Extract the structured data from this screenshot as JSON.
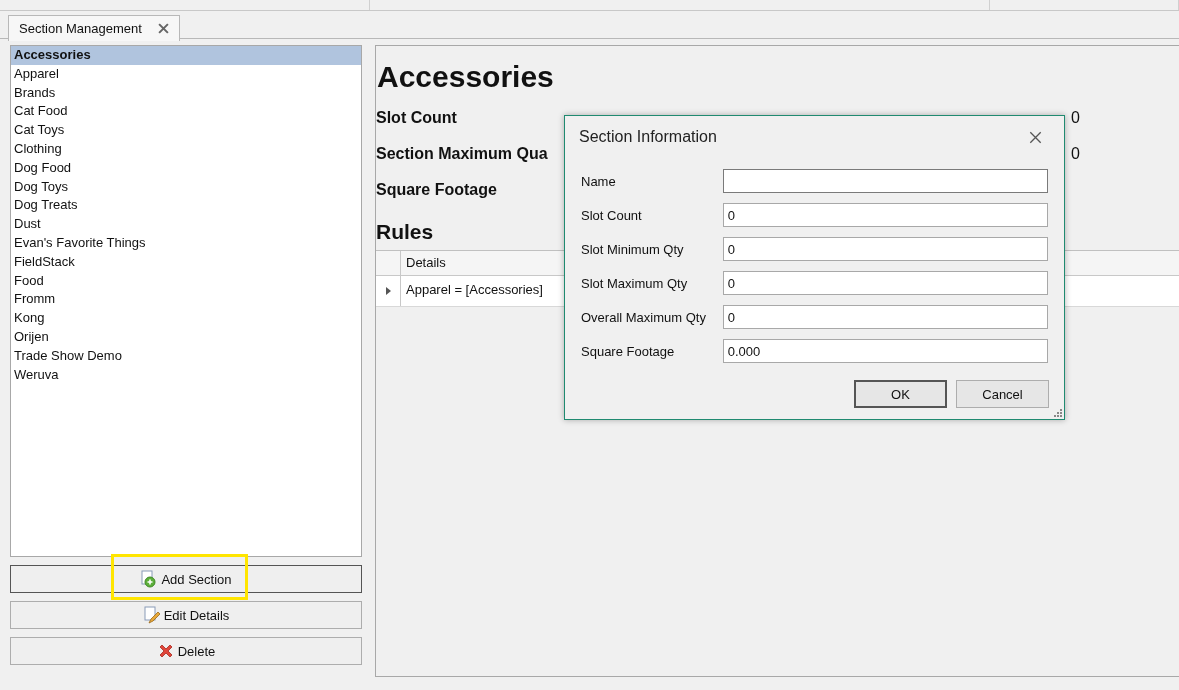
{
  "tabs": [
    {
      "label": "Section Management",
      "selected": true
    }
  ],
  "sections": [
    {
      "label": "Accessories",
      "selected": true
    },
    {
      "label": "Apparel",
      "selected": false
    },
    {
      "label": "Brands",
      "selected": false
    },
    {
      "label": "Cat Food",
      "selected": false
    },
    {
      "label": "Cat Toys",
      "selected": false
    },
    {
      "label": "Clothing",
      "selected": false
    },
    {
      "label": "Dog Food",
      "selected": false
    },
    {
      "label": "Dog Toys",
      "selected": false
    },
    {
      "label": "Dog Treats",
      "selected": false
    },
    {
      "label": "Dust",
      "selected": false
    },
    {
      "label": "Evan's Favorite Things",
      "selected": false
    },
    {
      "label": "FieldStack",
      "selected": false
    },
    {
      "label": "Food",
      "selected": false
    },
    {
      "label": "Fromm",
      "selected": false
    },
    {
      "label": "Kong",
      "selected": false
    },
    {
      "label": "Orijen",
      "selected": false
    },
    {
      "label": "Trade Show Demo",
      "selected": false
    },
    {
      "label": "Weruva",
      "selected": false
    }
  ],
  "actions": [
    {
      "label": "Add Section",
      "kind": "add",
      "highlighted": true
    },
    {
      "label": "Edit Details",
      "kind": "edit",
      "highlighted": false
    },
    {
      "label": "Delete",
      "kind": "delete",
      "highlighted": false
    }
  ],
  "detail": {
    "title": "Accessories",
    "fields": [
      {
        "label": "Slot Count",
        "value": "0"
      },
      {
        "label": "Section Maximum Qua",
        "value": "0"
      },
      {
        "label": "Square Footage"
      }
    ],
    "rules_title": "Rules",
    "rules_columns": [
      "Details"
    ],
    "rules_rows": [
      {
        "cells": [
          "Apparel = [Accessories]"
        ]
      }
    ]
  },
  "dialog": {
    "title": "Section Information",
    "fields": [
      {
        "label": "Name",
        "focused": true
      },
      {
        "label": "Slot Count",
        "value": "0",
        "focused": false
      },
      {
        "label": "Slot Minimum Qty",
        "value": "0",
        "focused": false
      },
      {
        "label": "Slot Maximum Qty",
        "value": "0",
        "focused": false
      },
      {
        "label": "Overall Maximum Qty",
        "value": "0",
        "focused": false
      },
      {
        "label": "Square Footage",
        "value": "0.000",
        "focused": false
      }
    ],
    "buttons": [
      {
        "label": "OK",
        "kind": "default"
      },
      {
        "label": "Cancel",
        "kind": "normal"
      }
    ]
  }
}
